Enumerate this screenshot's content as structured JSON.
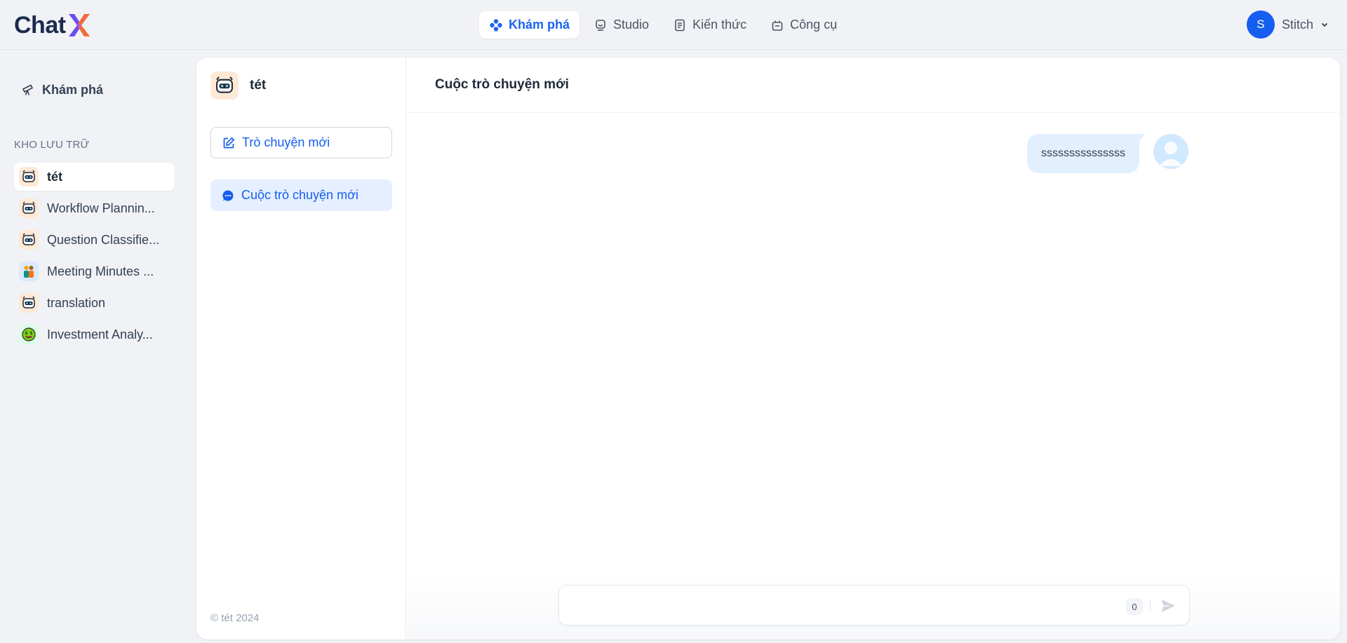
{
  "brand": {
    "name": "Chat"
  },
  "nav": {
    "items": [
      {
        "label": "Khám phá",
        "icon": "explore-icon",
        "active": true
      },
      {
        "label": "Studio",
        "icon": "robot-icon",
        "active": false
      },
      {
        "label": "Kiến thức",
        "icon": "book-icon",
        "active": false
      },
      {
        "label": "Công cụ",
        "icon": "toolbox-icon",
        "active": false
      }
    ]
  },
  "user": {
    "initial": "S",
    "name": "Stitch"
  },
  "sidebar": {
    "explore_label": "Khám phá",
    "section_title": "KHO LƯU TRỮ",
    "items": [
      {
        "label": "tét",
        "icon": "robot-avatar-icon"
      },
      {
        "label": "Workflow Plannin...",
        "icon": "robot-avatar-icon"
      },
      {
        "label": "Question Classifie...",
        "icon": "robot-avatar-icon"
      },
      {
        "label": "Meeting Minutes ...",
        "icon": "people-avatar-icon"
      },
      {
        "label": "translation",
        "icon": "robot-avatar-icon"
      },
      {
        "label": "Investment Analy...",
        "icon": "money-face-avatar-icon"
      }
    ]
  },
  "conversation_panel": {
    "app_title": "tét",
    "new_chat_label": "Trò chuyện mới",
    "conversations": [
      {
        "label": "Cuộc trò chuyện mới"
      }
    ],
    "copyright": "© tét 2024"
  },
  "chat": {
    "title": "Cuộc trò chuyện mới",
    "messages": [
      {
        "role": "user",
        "text": "sssssssssssssss"
      }
    ],
    "input_value": "",
    "char_count": "0"
  },
  "colors": {
    "accent": "#155eef",
    "page_bg": "#f0f2f5",
    "bubble_bg": "#e1effe"
  }
}
